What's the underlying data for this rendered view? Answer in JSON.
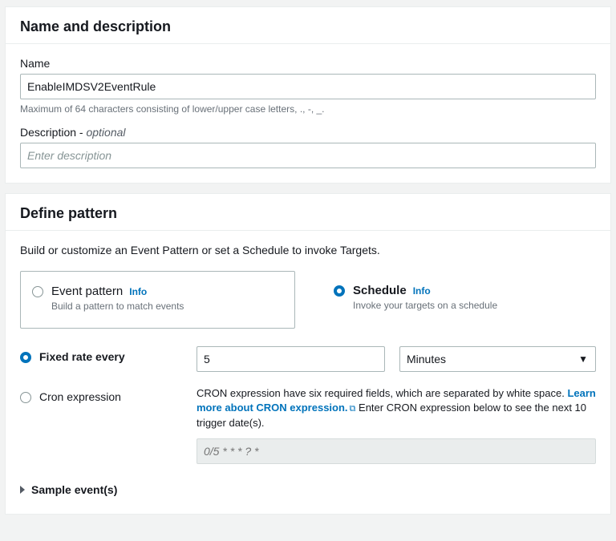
{
  "section_name_desc": {
    "heading": "Name and description",
    "name_label": "Name",
    "name_value": "EnableIMDSV2EventRule",
    "name_helper": "Maximum of 64 characters consisting of lower/upper case letters, ., -, _.",
    "desc_label": "Description - ",
    "desc_optional": "optional",
    "desc_placeholder": "Enter description"
  },
  "section_pattern": {
    "heading": "Define pattern",
    "intro": "Build or customize an Event Pattern or set a Schedule to invoke Targets.",
    "option_event_pattern": {
      "title": "Event pattern",
      "info": "Info",
      "desc": "Build a pattern to match events"
    },
    "option_schedule": {
      "title": "Schedule",
      "info": "Info",
      "desc": "Invoke your targets on a schedule"
    },
    "fixed_rate": {
      "label": "Fixed rate every",
      "value": "5",
      "unit": "Minutes"
    },
    "cron": {
      "label": "Cron expression",
      "desc_part1": "CRON expression have six required fields, which are separated by white space. ",
      "link1": "Learn more about CRON expression.",
      "desc_part2": " Enter CRON expression below to see the next 10 trigger date(s).",
      "placeholder": "0/5 * * * ? *"
    },
    "sample_events": "Sample event(s)"
  }
}
